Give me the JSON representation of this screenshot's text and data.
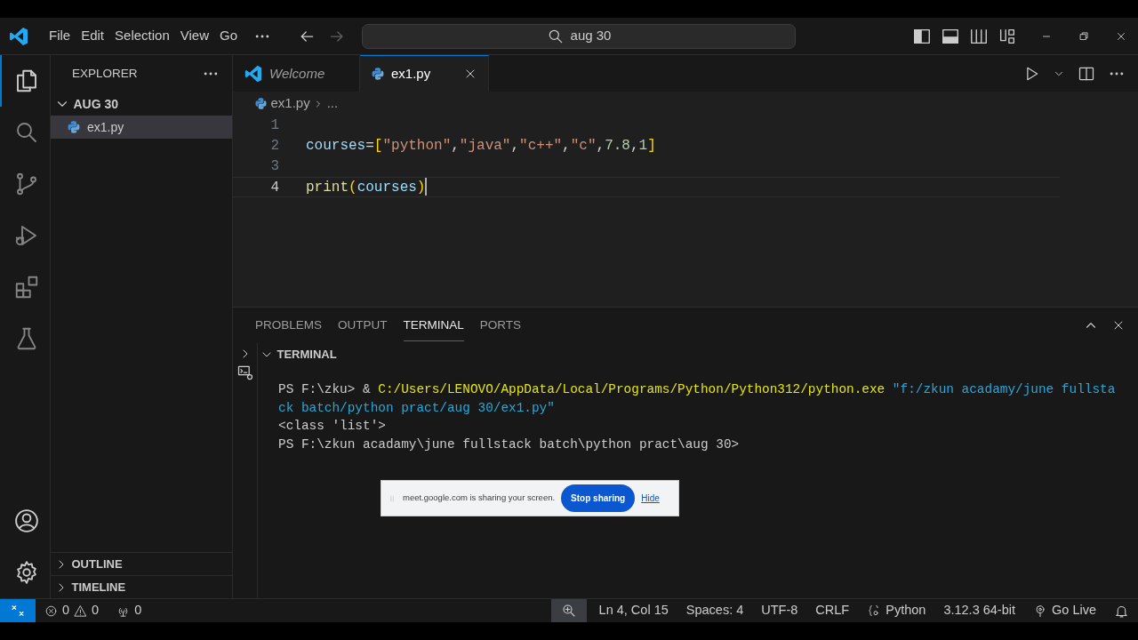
{
  "menu": [
    "File",
    "Edit",
    "Selection",
    "View",
    "Go"
  ],
  "nav": [
    {
      "kind": "back",
      "disabled": false
    },
    {
      "kind": "forward",
      "disabled": true
    }
  ],
  "search": {
    "value": "aug 30"
  },
  "activity_bar": [
    {
      "kind": "files",
      "selected": true
    },
    {
      "kind": "search",
      "selected": false
    },
    {
      "kind": "branch",
      "selected": false
    },
    {
      "kind": "run",
      "selected": false
    },
    {
      "kind": "extensions",
      "selected": false
    },
    {
      "kind": "flask",
      "selected": false
    }
  ],
  "sidebar": {
    "title": "EXPLORER",
    "folder": {
      "name": "AUG 30",
      "expanded": true,
      "children": [
        {
          "name": "ex1.py",
          "selected": true
        }
      ]
    },
    "sections": [
      {
        "name": "OUTLINE",
        "expanded": false
      },
      {
        "name": "TIMELINE",
        "expanded": false
      }
    ]
  },
  "tabs": [
    {
      "label": "Welcome",
      "kind": "welcome",
      "selected": false
    },
    {
      "label": "ex1.py",
      "kind": "python",
      "selected": true
    }
  ],
  "breadcrumb": {
    "file": "ex1.py",
    "rest": "..."
  },
  "code": [
    {
      "number": "1",
      "current": false
    },
    {
      "number": "2",
      "current": false,
      "tokens": [
        {
          "text": "courses",
          "kind": "variable"
        },
        {
          "text": "=",
          "kind": "punct"
        },
        {
          "text": "[",
          "kind": "bracket"
        },
        {
          "text": "\"python\"",
          "kind": "string"
        },
        {
          "text": ",",
          "kind": "punct"
        },
        {
          "text": "\"java\"",
          "kind": "string"
        },
        {
          "text": ",",
          "kind": "punct"
        },
        {
          "text": "\"c++\"",
          "kind": "string"
        },
        {
          "text": ",",
          "kind": "punct"
        },
        {
          "text": "\"c\"",
          "kind": "string"
        },
        {
          "text": ",",
          "kind": "punct"
        },
        {
          "text": "7.8",
          "kind": "number"
        },
        {
          "text": ",",
          "kind": "punct"
        },
        {
          "text": "1",
          "kind": "number"
        },
        {
          "text": "]",
          "kind": "bracket"
        }
      ]
    },
    {
      "number": "3",
      "current": false
    },
    {
      "number": "4",
      "current": true,
      "tokens": [
        {
          "text": "print",
          "kind": "function"
        },
        {
          "text": "(",
          "kind": "bracket"
        },
        {
          "text": "courses",
          "kind": "variable"
        },
        {
          "text": ")",
          "kind": "bracket"
        }
      ]
    }
  ],
  "panel": {
    "tabs": [
      {
        "label": "PROBLEMS",
        "selected": false
      },
      {
        "label": "OUTPUT",
        "selected": false
      },
      {
        "label": "TERMINAL",
        "selected": true
      },
      {
        "label": "PORTS",
        "selected": false
      }
    ],
    "terminal_title": "TERMINAL",
    "terminal_expanded": true,
    "lines": [
      {
        "segments": [
          {
            "text": "PS F:\\zku> & ",
            "kind": "plain"
          },
          {
            "text": "C:/Users/LENOVO/AppData/Local/Programs/Python/Python312/python.exe",
            "kind": "command"
          },
          {
            "text": " \"f:/zkun acadamy/june fullsta",
            "kind": "argument"
          }
        ]
      },
      {
        "segments": [
          {
            "text": "ck batch/python pract/aug 30/ex1.py\"",
            "kind": "argument"
          }
        ]
      },
      {
        "segments": [
          {
            "text": "<class 'list'>",
            "kind": "plain"
          }
        ]
      },
      {
        "segments": [
          {
            "text": "PS F:\\zkun acadamy\\june fullstack batch\\python pract\\aug 30>",
            "kind": "plain"
          }
        ]
      }
    ]
  },
  "share_bar": {
    "message": "meet.google.com is sharing your screen.",
    "button": "Stop sharing",
    "link": "Hide"
  },
  "status_bar": {
    "errors": "0",
    "warnings": "0",
    "ports": "0",
    "items": [
      {
        "kind": "zoom"
      },
      {
        "kind": "text",
        "text": "Ln 4, Col 15"
      },
      {
        "kind": "text",
        "text": "Spaces: 4"
      },
      {
        "kind": "text",
        "text": "UTF-8"
      },
      {
        "kind": "text",
        "text": "CRLF"
      },
      {
        "kind": "language",
        "text": "Python"
      },
      {
        "kind": "text",
        "text": "3.12.3 64-bit"
      },
      {
        "kind": "live",
        "text": "Go Live"
      },
      {
        "kind": "bell"
      }
    ]
  }
}
